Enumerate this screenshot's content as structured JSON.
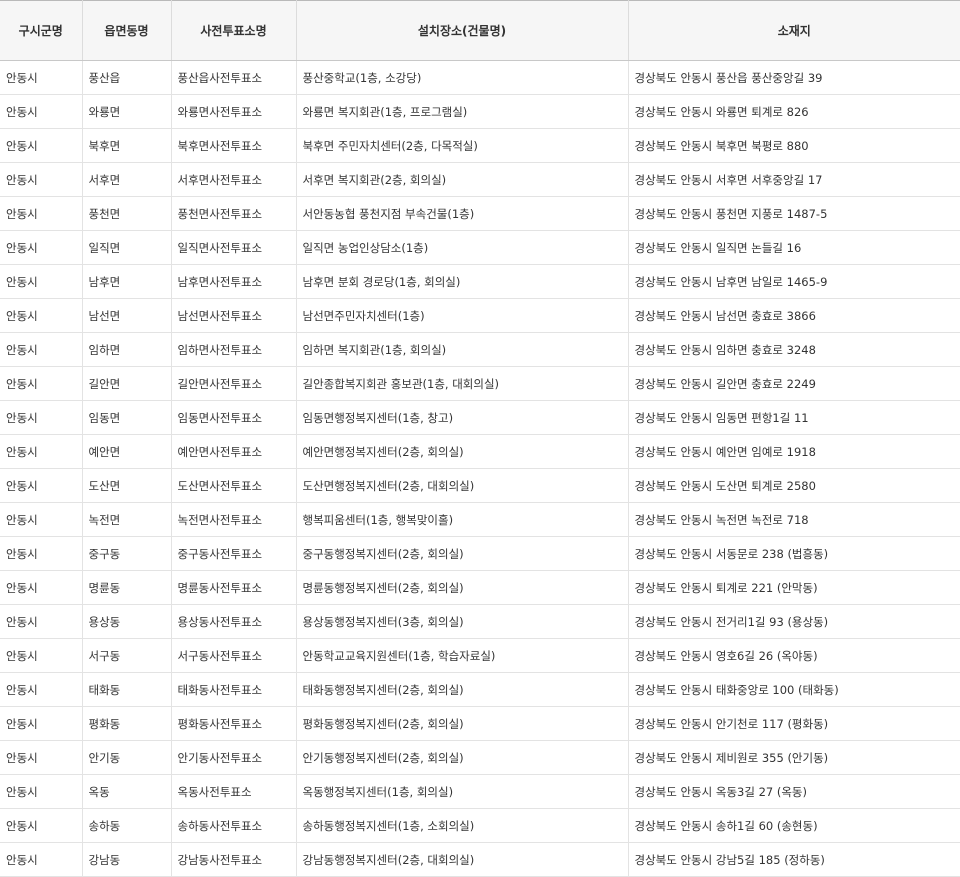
{
  "table": {
    "headers": [
      "구시군명",
      "읍면동명",
      "사전투표소명",
      "설치장소(건물명)",
      "소재지"
    ],
    "rows": [
      [
        "안동시",
        "풍산읍",
        "풍산읍사전투표소",
        "풍산중학교(1층, 소강당)",
        "경상북도 안동시 풍산읍 풍산중앙길 39"
      ],
      [
        "안동시",
        "와룡면",
        "와룡면사전투표소",
        "와룡면 복지회관(1층, 프로그램실)",
        "경상북도 안동시 와룡면 퇴계로 826"
      ],
      [
        "안동시",
        "북후면",
        "북후면사전투표소",
        "북후면 주민자치센터(2층, 다목적실)",
        "경상북도 안동시 북후면 북평로 880"
      ],
      [
        "안동시",
        "서후면",
        "서후면사전투표소",
        "서후면 복지회관(2층, 회의실)",
        "경상북도 안동시 서후면 서후중앙길 17"
      ],
      [
        "안동시",
        "풍천면",
        "풍천면사전투표소",
        "서안동농협 풍천지점 부속건물(1층)",
        "경상북도 안동시 풍천면 지풍로 1487-5"
      ],
      [
        "안동시",
        "일직면",
        "일직면사전투표소",
        "일직면 농업인상담소(1층)",
        "경상북도 안동시 일직면 논들길 16"
      ],
      [
        "안동시",
        "남후면",
        "남후면사전투표소",
        "남후면 분회 경로당(1층, 회의실)",
        "경상북도 안동시 남후면 남일로 1465-9"
      ],
      [
        "안동시",
        "남선면",
        "남선면사전투표소",
        "남선면주민자치센터(1층)",
        "경상북도 안동시 남선면 충효로 3866"
      ],
      [
        "안동시",
        "임하면",
        "임하면사전투표소",
        "임하면 복지회관(1층, 회의실)",
        "경상북도 안동시 임하면 충효로 3248"
      ],
      [
        "안동시",
        "길안면",
        "길안면사전투표소",
        "길안종합복지회관 홍보관(1층, 대회의실)",
        "경상북도 안동시 길안면 충효로 2249"
      ],
      [
        "안동시",
        "임동면",
        "임동면사전투표소",
        "임동면행정복지센터(1층, 창고)",
        "경상북도 안동시 임동면 편항1길 11"
      ],
      [
        "안동시",
        "예안면",
        "예안면사전투표소",
        "예안면행정복지센터(2층, 회의실)",
        "경상북도 안동시 예안면 임예로 1918"
      ],
      [
        "안동시",
        "도산면",
        "도산면사전투표소",
        "도산면행정복지센터(2층, 대회의실)",
        "경상북도 안동시 도산면 퇴계로 2580"
      ],
      [
        "안동시",
        "녹전면",
        "녹전면사전투표소",
        "행복피움센터(1층, 행복맞이홀)",
        "경상북도 안동시 녹전면 녹전로 718"
      ],
      [
        "안동시",
        "중구동",
        "중구동사전투표소",
        "중구동행정복지센터(2층, 회의실)",
        "경상북도 안동시 서동문로 238 (법흥동)"
      ],
      [
        "안동시",
        "명륜동",
        "명륜동사전투표소",
        "명륜동행정복지센터(2층, 회의실)",
        "경상북도 안동시 퇴계로 221 (안막동)"
      ],
      [
        "안동시",
        "용상동",
        "용상동사전투표소",
        "용상동행정복지센터(3층, 회의실)",
        "경상북도 안동시 전거리1길 93 (용상동)"
      ],
      [
        "안동시",
        "서구동",
        "서구동사전투표소",
        "안동학교교육지원센터(1층, 학습자료실)",
        "경상북도 안동시 영호6길 26 (옥야동)"
      ],
      [
        "안동시",
        "태화동",
        "태화동사전투표소",
        "태화동행정복지센터(2층, 회의실)",
        "경상북도 안동시 태화중앙로 100 (태화동)"
      ],
      [
        "안동시",
        "평화동",
        "평화동사전투표소",
        "평화동행정복지센터(2층, 회의실)",
        "경상북도 안동시 안기천로 117 (평화동)"
      ],
      [
        "안동시",
        "안기동",
        "안기동사전투표소",
        "안기동행정복지센터(2층, 회의실)",
        "경상북도 안동시 제비원로 355 (안기동)"
      ],
      [
        "안동시",
        "옥동",
        "옥동사전투표소",
        "옥동행정복지센터(1층, 회의실)",
        "경상북도 안동시 옥동3길 27 (옥동)"
      ],
      [
        "안동시",
        "송하동",
        "송하동사전투표소",
        "송하동행정복지센터(1층, 소회의실)",
        "경상북도 안동시 송하1길 60 (송현동)"
      ],
      [
        "안동시",
        "강남동",
        "강남동사전투표소",
        "강남동행정복지센터(2층, 대회의실)",
        "경상북도 안동시 강남5길 185 (정하동)"
      ]
    ]
  }
}
